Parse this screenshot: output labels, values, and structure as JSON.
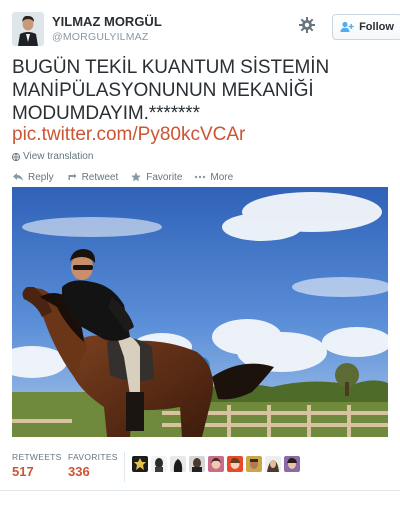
{
  "user": {
    "name": "YILMAZ MORGÜL",
    "handle": "@MORGULYILMAZ",
    "follow_label": "Follow"
  },
  "tweet": {
    "text": "BUGÜN TEKİL KUANTUM SİSTEMİN MANİPÜLASYONUNUN MEKANİĞİ MODUMDAYIM.*******",
    "link": "pic.twitter.com/Py80kcVCAr",
    "translate_label": "View translation"
  },
  "actions": {
    "reply": "Reply",
    "retweet": "Retweet",
    "favorite": "Favorite",
    "more": "More"
  },
  "stats": {
    "retweets_label": "RETWEETS",
    "retweets_value": "517",
    "favorites_label": "FAVORITES",
    "favorites_value": "336"
  },
  "colors": {
    "link": "#cc5533",
    "muted": "#66757f",
    "text": "#292f33"
  },
  "icons": [
    "gear-icon",
    "follow-person-icon",
    "globe-icon",
    "reply-icon",
    "retweet-icon",
    "favorite-star-icon",
    "more-dots-icon"
  ]
}
